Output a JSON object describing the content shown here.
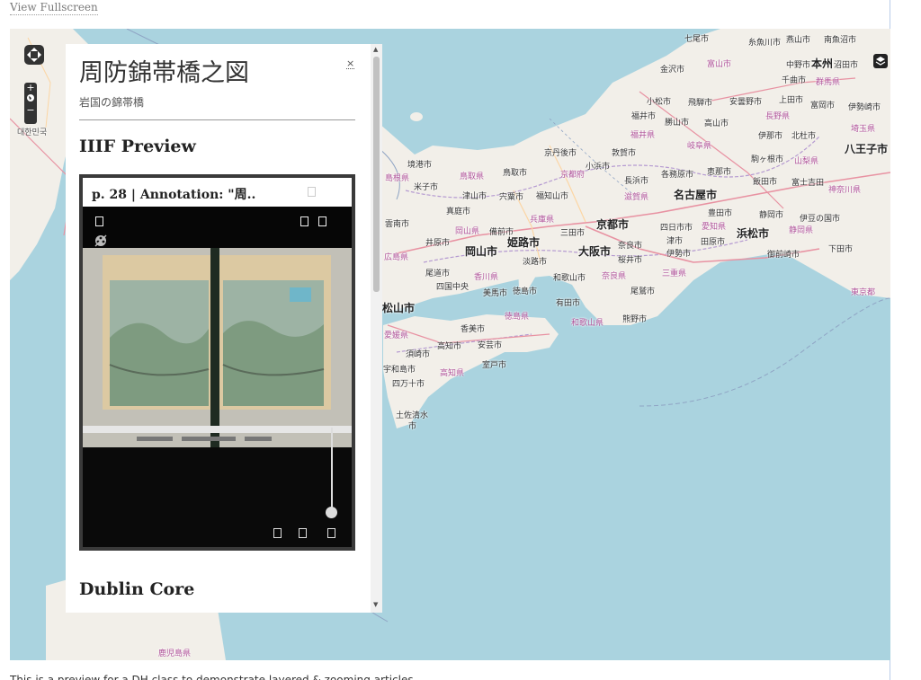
{
  "top": {
    "fullscreen_label": "View Fullscreen"
  },
  "colors": {
    "water": "#aad3df",
    "land": "#f2efe9",
    "panel_bg": "#ffffff",
    "viewer_bg": "#060606"
  },
  "map": {
    "labels": {
      "kanazawa": "金沢市",
      "toyama": "富山市",
      "nanao": "七尾市",
      "itoigawa": "糸魚川市",
      "mitsuke": "燕山市",
      "minamiuonuma": "南魚沼市",
      "nakanoshi": "中野市",
      "honshu": "本州",
      "numata": "沼田市",
      "chikuma": "千曲市",
      "gunma": "群馬県",
      "komatsu": "小松市",
      "hida": "飛騨市",
      "azumino": "安曇野市",
      "ueda": "上田市",
      "tomioka": "富岡市",
      "isesaki": "伊勢崎市",
      "fukui": "福井市",
      "katsuyama": "勝山市",
      "takayama": "高山市",
      "nagano": "長野県",
      "saitama": "埼玉県",
      "fukui_pref": "福井県",
      "gifu": "岐阜県",
      "ina": "伊那市",
      "hokuto": "北杜市",
      "hachioji": "八王子市",
      "komagane": "駒ヶ根市",
      "yamanashi": "山梨県",
      "kyotango": "京丹後市",
      "obama": "小浜市",
      "tsuruga": "敦賀市",
      "nagahama": "長浜市",
      "kakamigahara": "各務原市",
      "ena": "恵那市",
      "iida": "飯田市",
      "fujiyoshida": "富士吉田",
      "kanagawa": "神奈川県",
      "sakaiminato": "境港市",
      "shimane": "島根県",
      "tottori_pref": "鳥取県",
      "tottori": "鳥取市",
      "kyoto_pref": "京都府",
      "yonago": "米子市",
      "tsuyama": "津山市",
      "shiso": "宍粟市",
      "fukuchiyama": "福知山市",
      "shiga": "滋賀県",
      "nagoya": "名古屋市",
      "toyota": "豊田市",
      "shizuoka": "静岡市",
      "izunokuni": "伊豆の国市",
      "maniwa": "真庭市",
      "hyogo": "兵庫県",
      "unnan": "雲南市",
      "okayama_pref": "岡山県",
      "bizen": "備前市",
      "kyoto": "京都市",
      "yokkaichi": "四日市市",
      "aichi": "愛知県",
      "yasugi": "安来市",
      "ibara": "井原市",
      "okayama": "岡山市",
      "himeji": "姫路市",
      "sanda": "三田市",
      "osaka": "大阪市",
      "nara": "奈良市",
      "tsu": "津市",
      "tahara": "田原市",
      "hamamatsu": "浜松市",
      "shizuoka_pref": "静岡県",
      "hiroshima": "広島県",
      "ise": "伊勢市",
      "omaezaki": "御前崎市",
      "shimoda": "下田市",
      "awaji": "淡路市",
      "sakurai": "桜井市",
      "onomichi": "尾道市",
      "kagawa": "香川県",
      "wakayama_w": "和歌山市",
      "nara_pref": "奈良県",
      "mie": "三重県",
      "shikokuchuo": "四国中央",
      "mima": "美馬市",
      "tokushima": "徳島市",
      "arida": "有田市",
      "owase": "尾鷲市",
      "tokyo": "東京都",
      "matsuyama": "松山市",
      "tokushima_pref": "徳島県",
      "wakayama_pref": "和歌山県",
      "kumano": "熊野市",
      "kami": "香美市",
      "ehime": "愛媛県",
      "susaki": "須崎市",
      "kochi": "高知市",
      "aki": "安芸市",
      "uwajima": "宇和島市",
      "muroto": "室戸市",
      "kochi_pref": "高知県",
      "shimanto": "四万十市",
      "tosashimizu": "土佐清水",
      "tosashimizu2": "市",
      "korea": "대한민국",
      "kagoshima": "鹿児島県"
    }
  },
  "panel": {
    "title": "周防錦帯橋之図",
    "subtitle": "岩国の錦帯橋",
    "close_label": "×",
    "iiif_heading": "IIIF Preview",
    "dublin_heading": "Dublin Core",
    "viewer": {
      "header_text": "p. 28 | Annotation: \"周.."
    },
    "scroll_up": "▲",
    "scroll_down": "▼"
  },
  "bottom_text": "This is a preview for a DH class to demonstrate layered & zooming articles"
}
